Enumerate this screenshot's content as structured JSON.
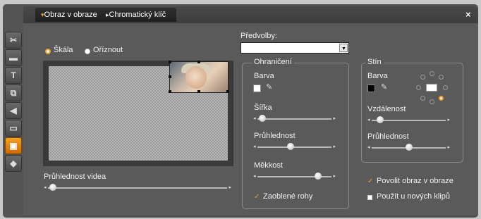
{
  "tabs": [
    {
      "label": "Obraz v obraze",
      "arrow": "▾"
    },
    {
      "label": "Chromatický klíč",
      "arrow": "▸"
    }
  ],
  "close_glyph": "×",
  "sidebar": {
    "items": [
      {
        "name": "scissors-icon",
        "glyph": "✂"
      },
      {
        "name": "film-icon",
        "glyph": "▬"
      },
      {
        "name": "text-icon",
        "glyph": "T"
      },
      {
        "name": "effects-icon",
        "glyph": "⧉"
      },
      {
        "name": "audio-icon",
        "glyph": "◀"
      },
      {
        "name": "clapper-icon",
        "glyph": "▭"
      },
      {
        "name": "pip-icon",
        "glyph": "▣",
        "active": true
      },
      {
        "name": "export-icon",
        "glyph": "◆"
      }
    ]
  },
  "mode": {
    "scale_label": "Škála",
    "crop_label": "Oříznout",
    "selected": "scale"
  },
  "video_opacity": {
    "label": "Průhlednost videa",
    "value": 0.02
  },
  "presets": {
    "label": "Předvolby:",
    "value": ""
  },
  "border": {
    "title": "Ohraničení",
    "color_label": "Barva",
    "color": "#ffffff",
    "width_label": "Šířka",
    "width_value": 0.05,
    "opacity_label": "Průhlednost",
    "opacity_value": 0.45,
    "softness_label": "Měkkost",
    "softness_value": 0.83,
    "rounded_label": "Zaoblené rohy",
    "rounded_checked": true
  },
  "shadow": {
    "title": "Stín",
    "color_label": "Barva",
    "color": "#000000",
    "distance_label": "Vzdálenost",
    "distance_value": 0.1,
    "opacity_label": "Průhlednost",
    "opacity_value": 0.5
  },
  "options": {
    "enable_label": "Povolit obraz v obraze",
    "enable_checked": true,
    "new_clips_label": "Použít u nových klipů",
    "new_clips_checked": false
  },
  "colors": {
    "accent": "#f0a030",
    "panel": "#5a5a5a",
    "frame": "#545454"
  }
}
